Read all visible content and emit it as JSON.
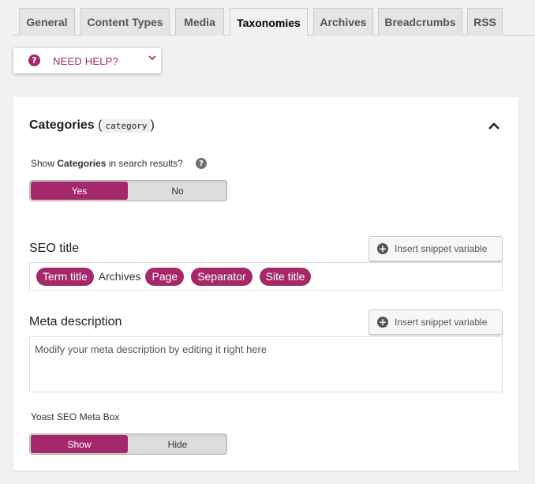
{
  "tabs": [
    "General",
    "Content Types",
    "Media",
    "Taxonomies",
    "Archives",
    "Breadcrumbs",
    "RSS"
  ],
  "active_tab": "Taxonomies",
  "help": {
    "label": "NEED HELP?"
  },
  "panel": {
    "title": "Categories",
    "slug": "category",
    "show_label_prefix": "Show",
    "show_label_bold": "Categories",
    "show_label_suffix": "in search results?",
    "toggle_yes": "Yes",
    "toggle_no": "No",
    "seo_title_label": "SEO title",
    "insert_snippet_label": "Insert snippet variable",
    "seo_tokens": [
      {
        "text": "Term title",
        "pill": true
      },
      {
        "text": "Archives",
        "pill": false
      },
      {
        "text": "Page",
        "pill": true
      },
      {
        "text": "Separator",
        "pill": true
      },
      {
        "text": "Site title",
        "pill": true
      }
    ],
    "meta_desc_label": "Meta description",
    "meta_desc_placeholder": "Modify your meta description by editing it right here",
    "meta_box_label": "Yoast SEO Meta Box",
    "meta_box_show": "Show",
    "meta_box_hide": "Hide"
  },
  "colors": {
    "accent": "#a4286a"
  }
}
